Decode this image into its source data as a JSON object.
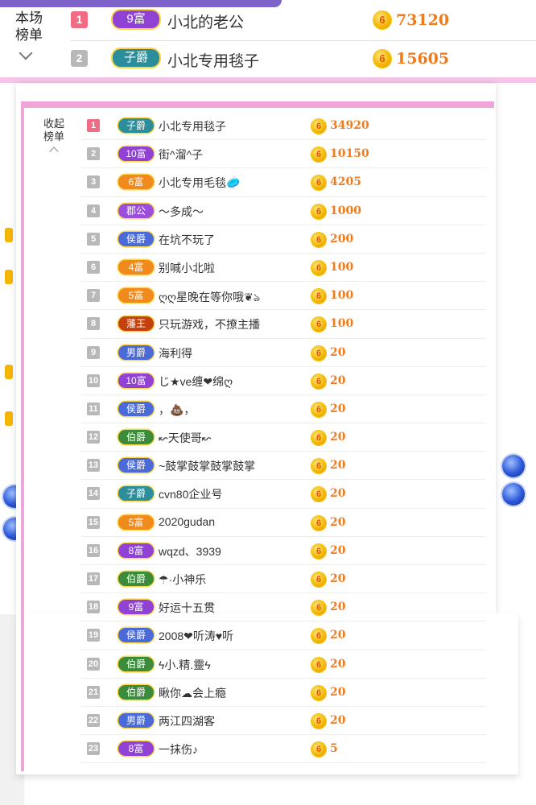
{
  "header": {
    "label_line1": "本场",
    "label_line2": "榜单"
  },
  "top_rows": [
    {
      "rank": "1",
      "tier": "9富",
      "name": "小北的老公",
      "score": "73120"
    },
    {
      "rank": "2",
      "tier": "子爵",
      "name": "小北专用毯子",
      "score": "15605"
    }
  ],
  "popup": {
    "collapse_line1": "收起",
    "collapse_line2": "榜单",
    "coin_glyph": "6",
    "rows": [
      {
        "rank": "1",
        "tier": "子爵",
        "tier_color": "teal",
        "name": "小北专用毯子",
        "score": "34920"
      },
      {
        "rank": "2",
        "tier": "10富",
        "tier_color": "purple",
        "name": "街^溜^子",
        "score": "10150"
      },
      {
        "rank": "3",
        "tier": "6富",
        "tier_color": "orange",
        "name": "小北专用毛毯🥏",
        "score": "4205"
      },
      {
        "rank": "4",
        "tier": "郡公",
        "tier_color": "violet",
        "name": "～多成～",
        "score": "1000"
      },
      {
        "rank": "5",
        "tier": "侯爵",
        "tier_color": "blue",
        "name": "在坑不玩了",
        "score": "200"
      },
      {
        "rank": "6",
        "tier": "4富",
        "tier_color": "orange",
        "name": "别喊小北啦",
        "score": "100"
      },
      {
        "rank": "7",
        "tier": "5富",
        "tier_color": "orange",
        "name": "ღღ星晚在等你哦❦ঌ",
        "score": "100"
      },
      {
        "rank": "8",
        "tier": "藩王",
        "tier_color": "red",
        "name": "只玩游戏，不撩主播",
        "score": "100"
      },
      {
        "rank": "9",
        "tier": "男爵",
        "tier_color": "blue",
        "name": "海利得",
        "score": "20"
      },
      {
        "rank": "10",
        "tier": "10富",
        "tier_color": "purple",
        "name": "じ★ve缠❤绵ღ",
        "score": "20"
      },
      {
        "rank": "11",
        "tier": "侯爵",
        "tier_color": "blue",
        "name": "，💩，",
        "score": "20"
      },
      {
        "rank": "12",
        "tier": "伯爵",
        "tier_color": "green",
        "name": "↜天使哥↜",
        "score": "20"
      },
      {
        "rank": "13",
        "tier": "侯爵",
        "tier_color": "blue",
        "name": "~鼓掌鼓掌鼓掌鼓掌",
        "score": "20"
      },
      {
        "rank": "14",
        "tier": "子爵",
        "tier_color": "teal",
        "name": "cvn80企业号",
        "score": "20"
      },
      {
        "rank": "15",
        "tier": "5富",
        "tier_color": "orange",
        "name": "2020gudan",
        "score": "20"
      },
      {
        "rank": "16",
        "tier": "8富",
        "tier_color": "purple",
        "name": "wqzd、3939",
        "score": "20"
      },
      {
        "rank": "17",
        "tier": "伯爵",
        "tier_color": "green",
        "name": "☂·小神乐",
        "score": "20"
      },
      {
        "rank": "18",
        "tier": "9富",
        "tier_color": "purple",
        "name": "好运十五贯",
        "score": "20"
      },
      {
        "rank": "19",
        "tier": "侯爵",
        "tier_color": "blue",
        "name": "2008❤听涛♥听",
        "score": "20"
      },
      {
        "rank": "20",
        "tier": "伯爵",
        "tier_color": "green",
        "name": "ϟ小.精.靈ϟ",
        "score": "20"
      },
      {
        "rank": "21",
        "tier": "伯爵",
        "tier_color": "green",
        "name": "瞅你☁会上瘾",
        "score": "20"
      },
      {
        "rank": "22",
        "tier": "男爵",
        "tier_color": "blue",
        "name": "两江四湖客",
        "score": "20"
      },
      {
        "rank": "23",
        "tier": "8富",
        "tier_color": "purple",
        "name": "一抹伤♪",
        "score": "5"
      }
    ]
  },
  "colors": {
    "accent_pink": "#f0a5d8",
    "rank1": "#f06b83",
    "rank_other": "#b8b8b8",
    "score": "#f07b1d",
    "coin": "#f2b400"
  },
  "icons": [
    "chevron-down-icon",
    "chevron-up-icon",
    "coin-icon"
  ]
}
